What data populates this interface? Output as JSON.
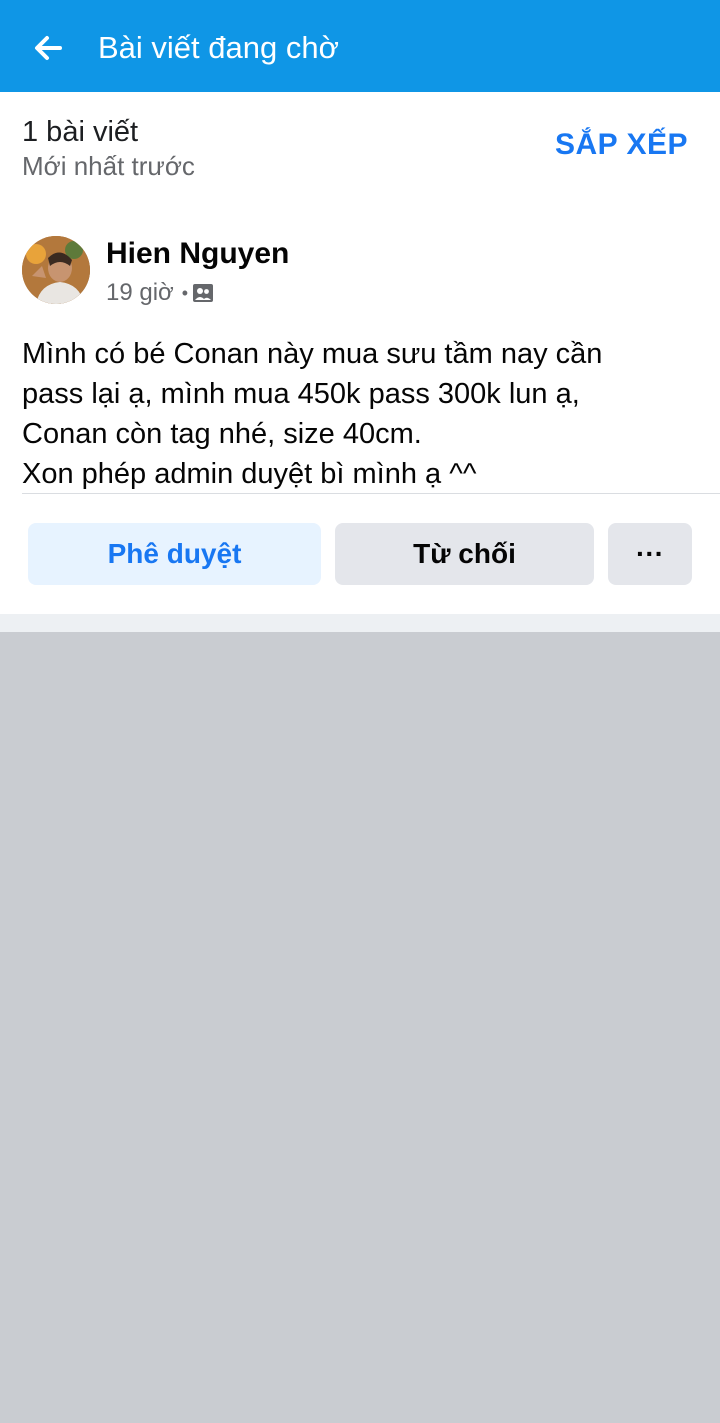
{
  "header": {
    "title": "Bài viết đang chờ",
    "back_icon": "arrow-left-icon"
  },
  "summary": {
    "count_text": "1 bài viết",
    "sort_order": "Mới nhất trước",
    "sort_label": "SẮP XẾP"
  },
  "post": {
    "author": "Hien Nguyen",
    "time": "19 giờ",
    "separator": "•",
    "audience_icon": "group-icon",
    "text_lines": [
      "Mình có bé Conan này mua sưu tầm nay cần",
      "pass lại ạ, mình mua 450k pass 300k lun ạ,",
      "Conan còn tag nhé, size 40cm.",
      "Xon phép admin duyệt bì mình ạ ^^"
    ]
  },
  "actions": {
    "approve_label": "Phê duyệt",
    "decline_label": "Từ chối",
    "more_label": "···"
  },
  "colors": {
    "appbar": "#0f96e6",
    "accent": "#1877f2",
    "approve_bg": "#e7f3ff",
    "secondary_bg": "#e4e6eb",
    "page_bg": "#c9ccd1"
  }
}
